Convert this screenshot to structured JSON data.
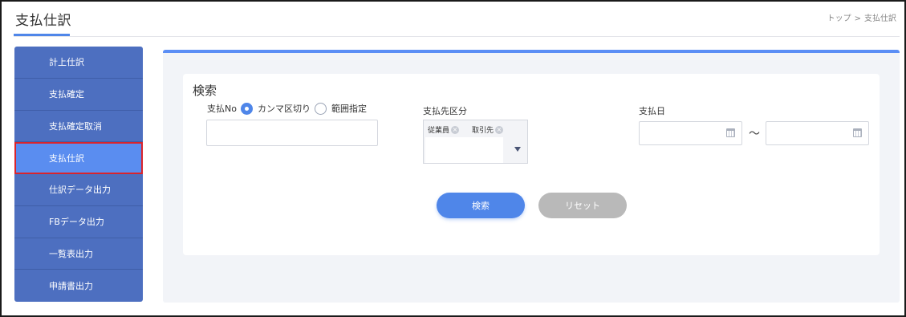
{
  "header": {
    "title": "支払仕訳",
    "breadcrumb": {
      "home": "トップ",
      "separator": ">",
      "current": "支払仕訳"
    }
  },
  "sidebar": {
    "items": [
      {
        "label": "計上仕訳"
      },
      {
        "label": "支払確定"
      },
      {
        "label": "支払確定取消"
      },
      {
        "label": "支払仕訳",
        "active": true
      },
      {
        "label": "仕訳データ出力"
      },
      {
        "label": "FBデータ出力"
      },
      {
        "label": "一覧表出力"
      },
      {
        "label": "申請書出力"
      }
    ]
  },
  "search": {
    "title": "検索",
    "payment_no": {
      "label": "支払No",
      "option_comma": "カンマ区切り",
      "option_range": "範囲指定",
      "selected": "カンマ区切り",
      "value": ""
    },
    "payee_type": {
      "label": "支払先区分",
      "tags": [
        "従業員",
        "取引先"
      ],
      "tag_remove_icon": "close-circle-icon",
      "dropdown_icon": "caret-down-icon"
    },
    "payment_date": {
      "label": "支払日",
      "from": "",
      "to": "",
      "separator": "～",
      "calendar_icon": "calendar-icon"
    },
    "search_button": "検索",
    "reset_button": "リセット"
  },
  "colors": {
    "accent": "#4f86e9",
    "sidebar_bg": "#4d6fc0",
    "sidebar_active": "#5a8df0",
    "active_outline": "#d9242c",
    "reset_bg": "#b9b9b9"
  }
}
